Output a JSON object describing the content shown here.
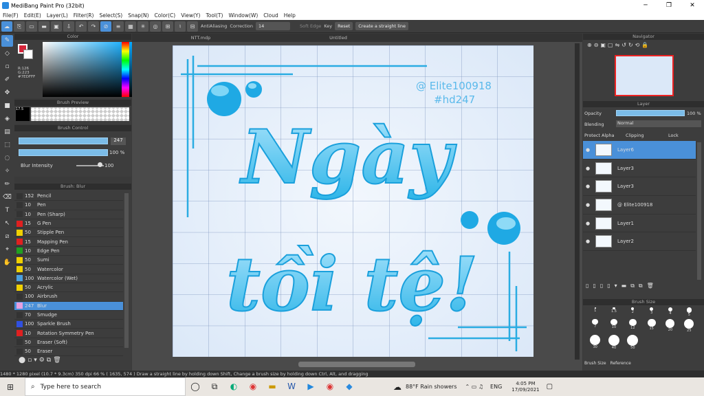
{
  "window": {
    "title": "MediBang Paint Pro (32bit)",
    "min": "─",
    "max": "❐",
    "close": "✕"
  },
  "menu": [
    "File(F)",
    "Edit(E)",
    "Layer(L)",
    "Filter(R)",
    "Select(S)",
    "Snap(N)",
    "Color(C)",
    "View(Y)",
    "Tool(T)",
    "Window(W)",
    "Cloud",
    "Help"
  ],
  "toolbar": {
    "antialiasing": "AntiAliasing",
    "correction_label": "Correction",
    "correction_value": "14",
    "soft_edge": "Soft Edge",
    "key": "Key",
    "reset": "Reset",
    "straight_line": "Create a straight line"
  },
  "color_panel": {
    "title": "Color",
    "r": "R:126",
    "g": "G:223",
    "hex": "#7EDFFF"
  },
  "brush_preview": {
    "title": "Brush Preview",
    "size_label": "17.5"
  },
  "brush_control": {
    "title": "Brush Control",
    "size": "247",
    "opacity": "100 %",
    "blur_label": "Blur Intensity",
    "blur_value": "100"
  },
  "brush_list": {
    "title": "Brush: Blur",
    "items": [
      {
        "size": "152",
        "name": "Pencil",
        "color": "#333333"
      },
      {
        "size": "10",
        "name": "Pen",
        "color": "#333333"
      },
      {
        "size": "10",
        "name": "Pen (Sharp)",
        "color": "#333333"
      },
      {
        "size": "15",
        "name": "G Pen",
        "color": "#e02020"
      },
      {
        "size": "50",
        "name": "Stipple Pen",
        "color": "#f0d000"
      },
      {
        "size": "15",
        "name": "Mapping Pen",
        "color": "#e02020"
      },
      {
        "size": "10",
        "name": "Edge Pen",
        "color": "#20a020"
      },
      {
        "size": "50",
        "name": "Sumi",
        "color": "#f0d000"
      },
      {
        "size": "50",
        "name": "Watercolor",
        "color": "#f0d000"
      },
      {
        "size": "100",
        "name": "Watercolor (Wet)",
        "color": "#4aa0e0"
      },
      {
        "size": "50",
        "name": "Acrylic",
        "color": "#f0d000"
      },
      {
        "size": "100",
        "name": "Airbrush",
        "color": "#333333"
      },
      {
        "size": "247",
        "name": "Blur",
        "color": "#e8a0e0"
      },
      {
        "size": "70",
        "name": "Smudge",
        "color": "#333333"
      },
      {
        "size": "100",
        "name": "Sparkle Brush",
        "color": "#3050e0"
      },
      {
        "size": "10",
        "name": "Rotation Symmetry Pen",
        "color": "#e02020"
      },
      {
        "size": "50",
        "name": "Eraser (Soft)",
        "color": "#333333"
      },
      {
        "size": "50",
        "name": "Eraser",
        "color": "#333333"
      }
    ]
  },
  "tabs": [
    "NTT.mdp",
    "Untitled"
  ],
  "canvas": {
    "handle1": "@ Elite100918",
    "handle2": "#hd247",
    "line1": "Ngày",
    "line2": "tồi tệ!"
  },
  "navigator": {
    "title": "Navigator"
  },
  "layer_panel": {
    "title": "Layer",
    "opacity_label": "Opacity",
    "opacity_value": "100 %",
    "blending_label": "Blending",
    "blending_value": "Normal",
    "protect_alpha": "Protect Alpha",
    "clipping": "Clipping",
    "lock": "Lock",
    "layers": [
      "Layer6",
      "Layer3",
      "Layer3",
      "@ Elite100918",
      "Layer1",
      "Layer2"
    ]
  },
  "brush_size": {
    "title": "Brush Size",
    "labels": [
      "1",
      "1.5",
      "2",
      "3",
      "4",
      "5",
      "7",
      "10",
      "12",
      "15",
      "20",
      "25",
      "30",
      "40",
      "50"
    ],
    "tab1": "Brush Size",
    "tab2": "Reference"
  },
  "status": "1480 * 1280 pixel  (10.7 * 9.3cm)  350 dpi  66 %  ( 1635, 574 )  Draw a straight line by holding down Shift, Change a brush size by holding down Ctrl, Alt, and dragging",
  "taskbar": {
    "search": "Type here to search",
    "weather": "88°F  Rain showers",
    "lang": "ENG",
    "time": "4:05 PM",
    "date": "17/09/2021"
  }
}
